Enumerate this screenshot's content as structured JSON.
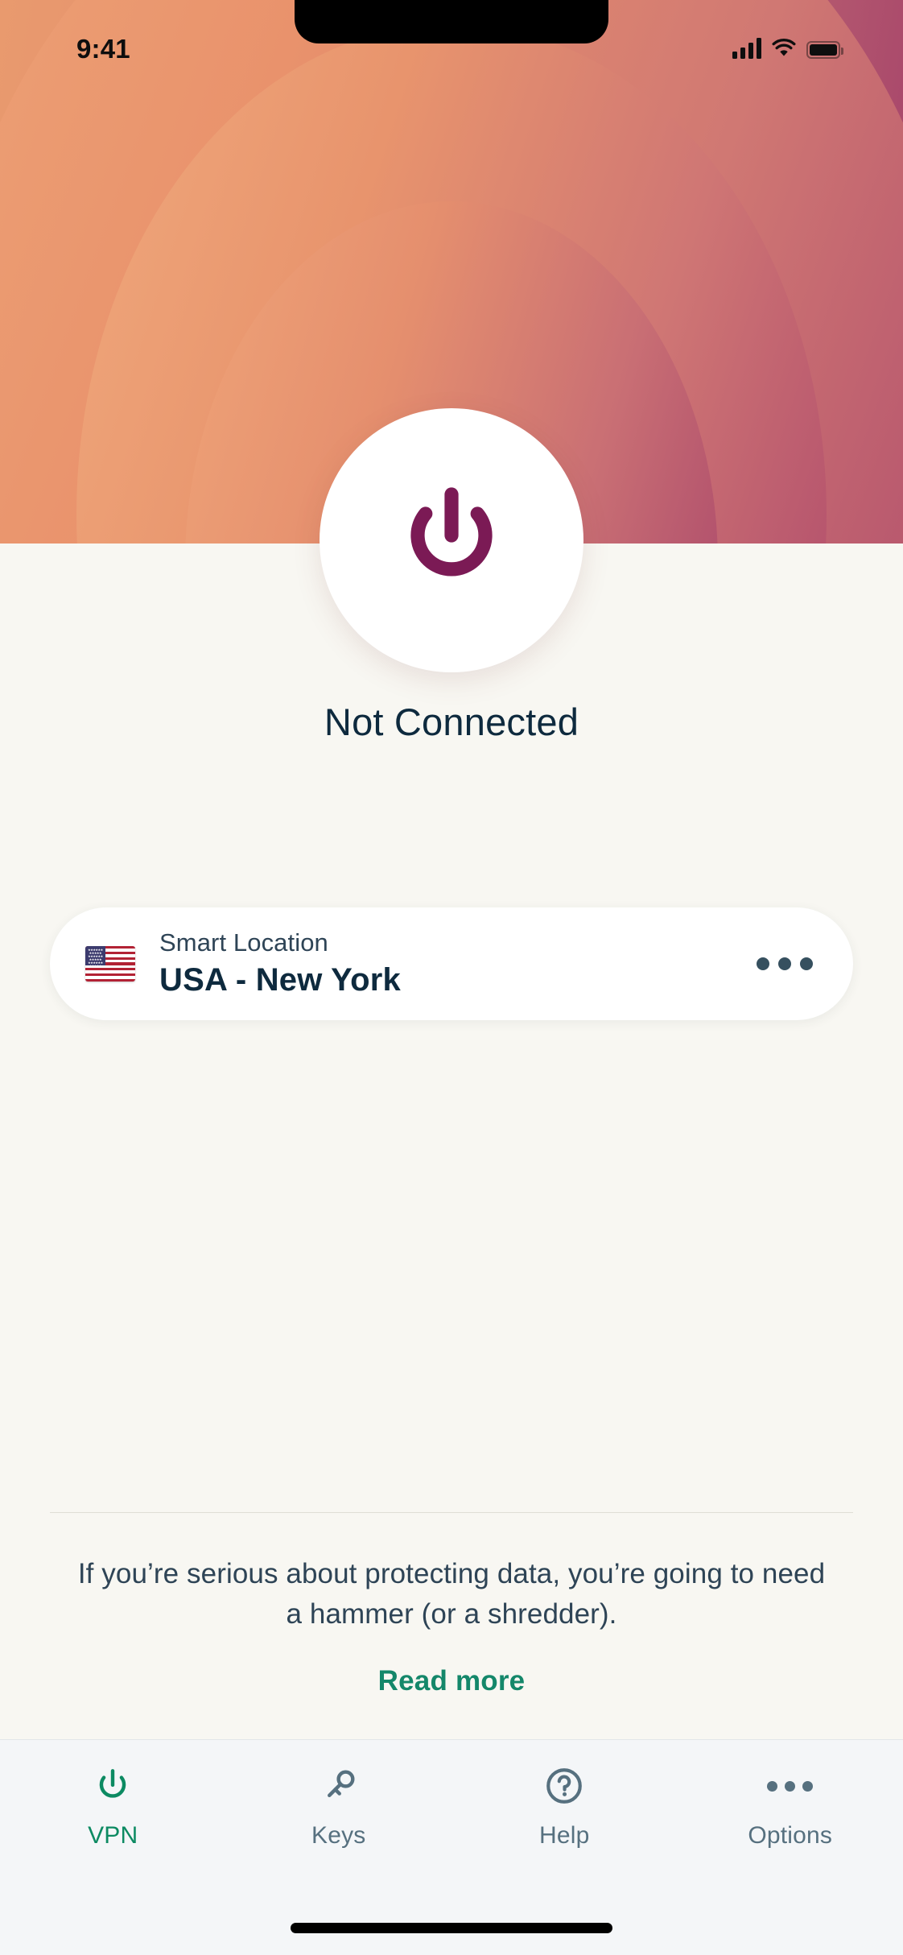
{
  "status_bar": {
    "time": "9:41",
    "cellular_icon": "signal-bars-icon",
    "wifi_icon": "wifi-icon",
    "battery_icon": "battery-full-icon"
  },
  "hero": {
    "power_button_icon": "power-icon",
    "connection_status": "Not Connected",
    "gradient_start": "#E99A6E",
    "gradient_end": "#A33F69",
    "power_icon_color": "#7B1A55",
    "background": "#F8F7F2"
  },
  "location_card": {
    "flag_icon": "usa-flag-icon",
    "label": "Smart Location",
    "value": "USA - New York",
    "more_icon": "ellipsis-icon"
  },
  "promo": {
    "text": "If you’re serious about protecting data, you’re going to need a hammer (or a shredder).",
    "link_label": "Read more",
    "link_color": "#14876A"
  },
  "tabbar": {
    "active_color": "#0C8A62",
    "inactive_color": "#56707F",
    "items": [
      {
        "label": "VPN",
        "icon": "power-icon",
        "active": true
      },
      {
        "label": "Keys",
        "icon": "key-icon",
        "active": false
      },
      {
        "label": "Help",
        "icon": "question-circle-icon",
        "active": false
      },
      {
        "label": "Options",
        "icon": "ellipsis-icon",
        "active": false
      }
    ]
  }
}
